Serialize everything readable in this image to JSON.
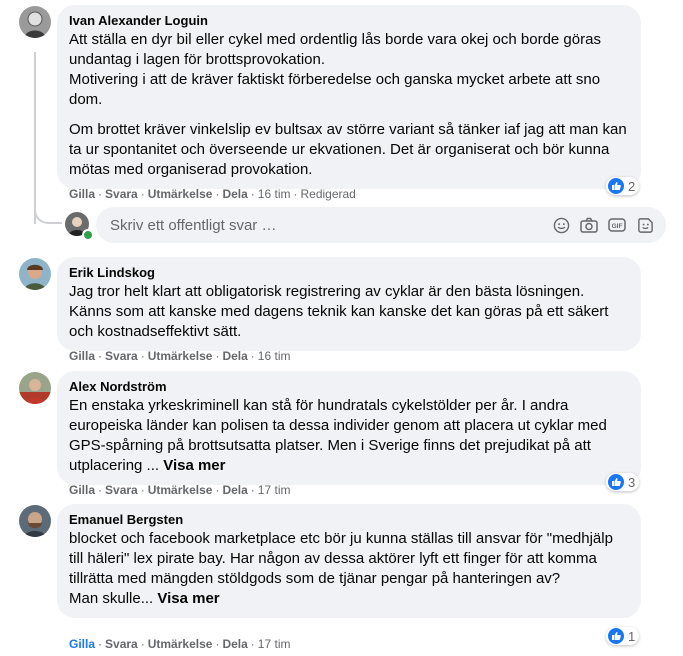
{
  "actions": {
    "like": "Gilla",
    "reply": "Svara",
    "award": "Utmärkelse",
    "share": "Dela",
    "dot": "·"
  },
  "comments": [
    {
      "author": "Ivan Alexander Loguin",
      "paragraphs": [
        "Att ställa en dyr bil eller cykel med ordentlig lås borde vara okej och borde göras undantag i lagen för brottsprovokation.\nMotivering i att de kräver faktiskt förberedelse och ganska mycket arbete att sno dom.",
        "Om brottet kräver vinkelslip ev bultsax av större variant så tänker iaf jag att man kan ta ur spontanitet och överseende ur ekvationen. Det är organiserat och bör kunna mötas med organiserad provokation."
      ],
      "time": "16 tim",
      "edited": "Redigerad",
      "reactions": "2"
    },
    {
      "author": "Erik Lindskog",
      "paragraphs": [
        "Jag tror helt klart att obligatorisk registrering av cyklar är den bästa lösningen. Känns som att kanske med dagens teknik kan kanske det kan göras på ett säkert och kostnadseffektivt sätt."
      ],
      "time": "16 tim"
    },
    {
      "author": "Alex Nordström",
      "text": "En enstaka yrkeskriminell kan stå för hundratals cykelstölder per år. I andra europeiska länder kan polisen ta dessa individer genom att placera ut cyklar med GPS-spårning på brottsutsatta platser. Men i Sverige finns det prejudikat på att utplacering ... ",
      "see_more": "Visa mer",
      "time": "17 tim",
      "reactions": "3"
    },
    {
      "author": "Emanuel Bergsten",
      "text": "blocket och facebook marketplace etc bör ju kunna ställas till ansvar för \"medhjälp till häleri\" lex pirate bay. Har någon av dessa aktörer lyft ett finger för att komma tillrätta med mängden stöldgods som de tjänar pengar på hanteringen av?\nMan skulle... ",
      "see_more": "Visa mer",
      "time": "17 tim",
      "reactions": "1"
    }
  ],
  "reply": {
    "placeholder": "Skriv ett offentligt svar …"
  },
  "colors": {
    "accent": "#1877f2",
    "bubble": "#f0f2f5",
    "meta": "#65676b",
    "online": "#31a24c"
  }
}
